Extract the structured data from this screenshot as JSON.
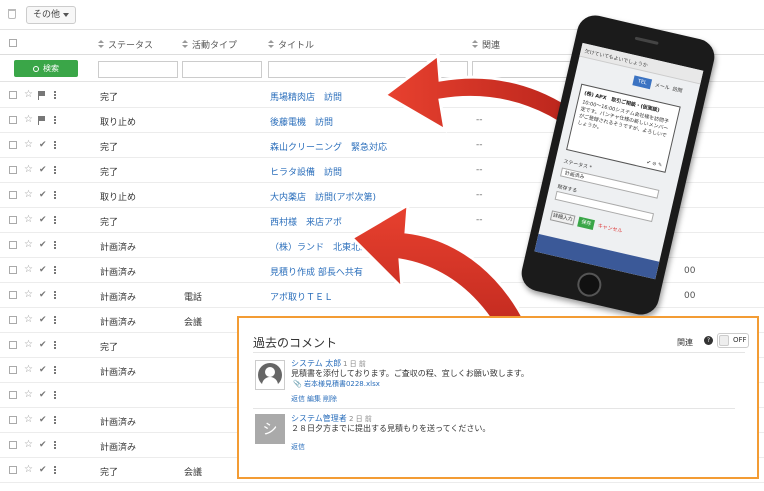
{
  "toolbar": {
    "other_label": "その他"
  },
  "table": {
    "headers": {
      "status": "ステータス",
      "activity_type": "活動タイプ",
      "title": "タイトル",
      "related": "関連"
    },
    "search_label": "検索",
    "rows": [
      {
        "status": "完了",
        "type": "",
        "title": "馬場精肉店　訪問",
        "related": "--"
      },
      {
        "status": "取り止め",
        "type": "",
        "title": "後藤電機　訪問",
        "related": "--"
      },
      {
        "status": "完了",
        "type": "",
        "title": "森山クリーニング　緊急対応",
        "related": "--"
      },
      {
        "status": "完了",
        "type": "",
        "title": "ヒラタ設備　訪問",
        "related": "--"
      },
      {
        "status": "取り止め",
        "type": "",
        "title": "大内薬店　訪問(アポ次第)",
        "related": "--"
      },
      {
        "status": "完了",
        "type": "",
        "title": "西村様　来店アポ",
        "related": "--"
      },
      {
        "status": "計画済み",
        "type": "",
        "title": "（株）ランド　北東北工場",
        "related": ""
      },
      {
        "status": "計画済み",
        "type": "",
        "title": "見積り作成 部長へ共有",
        "related": ""
      },
      {
        "status": "計画済み",
        "type": "電話",
        "title": "アポ取りＴＥＬ",
        "related": ""
      },
      {
        "status": "計画済み",
        "type": "会議",
        "title": "",
        "related": ""
      },
      {
        "status": "完了",
        "type": "",
        "title": "",
        "related": ""
      },
      {
        "status": "計画済み",
        "type": "",
        "title": "",
        "related": ""
      },
      {
        "status": "",
        "type": "",
        "title": "",
        "related": ""
      },
      {
        "status": "計画済み",
        "type": "",
        "title": "",
        "related": ""
      },
      {
        "status": "計画済み",
        "type": "",
        "title": "",
        "related": ""
      },
      {
        "status": "完了",
        "type": "会議",
        "title": "",
        "related": ""
      }
    ],
    "extra_1": "00",
    "extra_2": "00"
  },
  "phone": {
    "header": "欠けていてもよいでしょうか",
    "tab_selected": "TEL",
    "tab_2": "メール",
    "tab_3": "訪問",
    "bubble_title": "(株) APX　取引ご相談・(仮面談)",
    "bubble_body": "10:00〜16:00システム会社様を訪問予定です。バンチャ仕様の新しいメンバーがご登録されるそうですが、よろしいでしょうか。",
    "bubble_icons": "✔ ⊘ ✎",
    "status_label": "ステータス *",
    "status_value": "計画済み",
    "type_label": "既存する",
    "btn_detail": "詳細入力",
    "btn_save": "保存",
    "btn_cancel": "キャンセル"
  },
  "comments": {
    "title": "過去のコメント",
    "related_label": "関連",
    "toggle_label": "OFF",
    "items": [
      {
        "author": "システム 太郎",
        "time": "1 日 前",
        "text": "見積書を添付しております。ご査収の程、宜しくお願い致します。",
        "attachment": "📎 岩本様見積書0228.xlsx",
        "actions": [
          "返信",
          "編集",
          "削除"
        ]
      },
      {
        "author": "システム管理者",
        "time": "2 日 前",
        "text": "２８日夕方までに提出する見積もりを送ってください。",
        "avatar_text": "シ",
        "actions": [
          "返信"
        ]
      }
    ]
  },
  "colors": {
    "accent_green": "#3aa648",
    "link_blue": "#2a6ebb",
    "panel_border": "#f39c34",
    "arrow_red": "#d8362a"
  }
}
